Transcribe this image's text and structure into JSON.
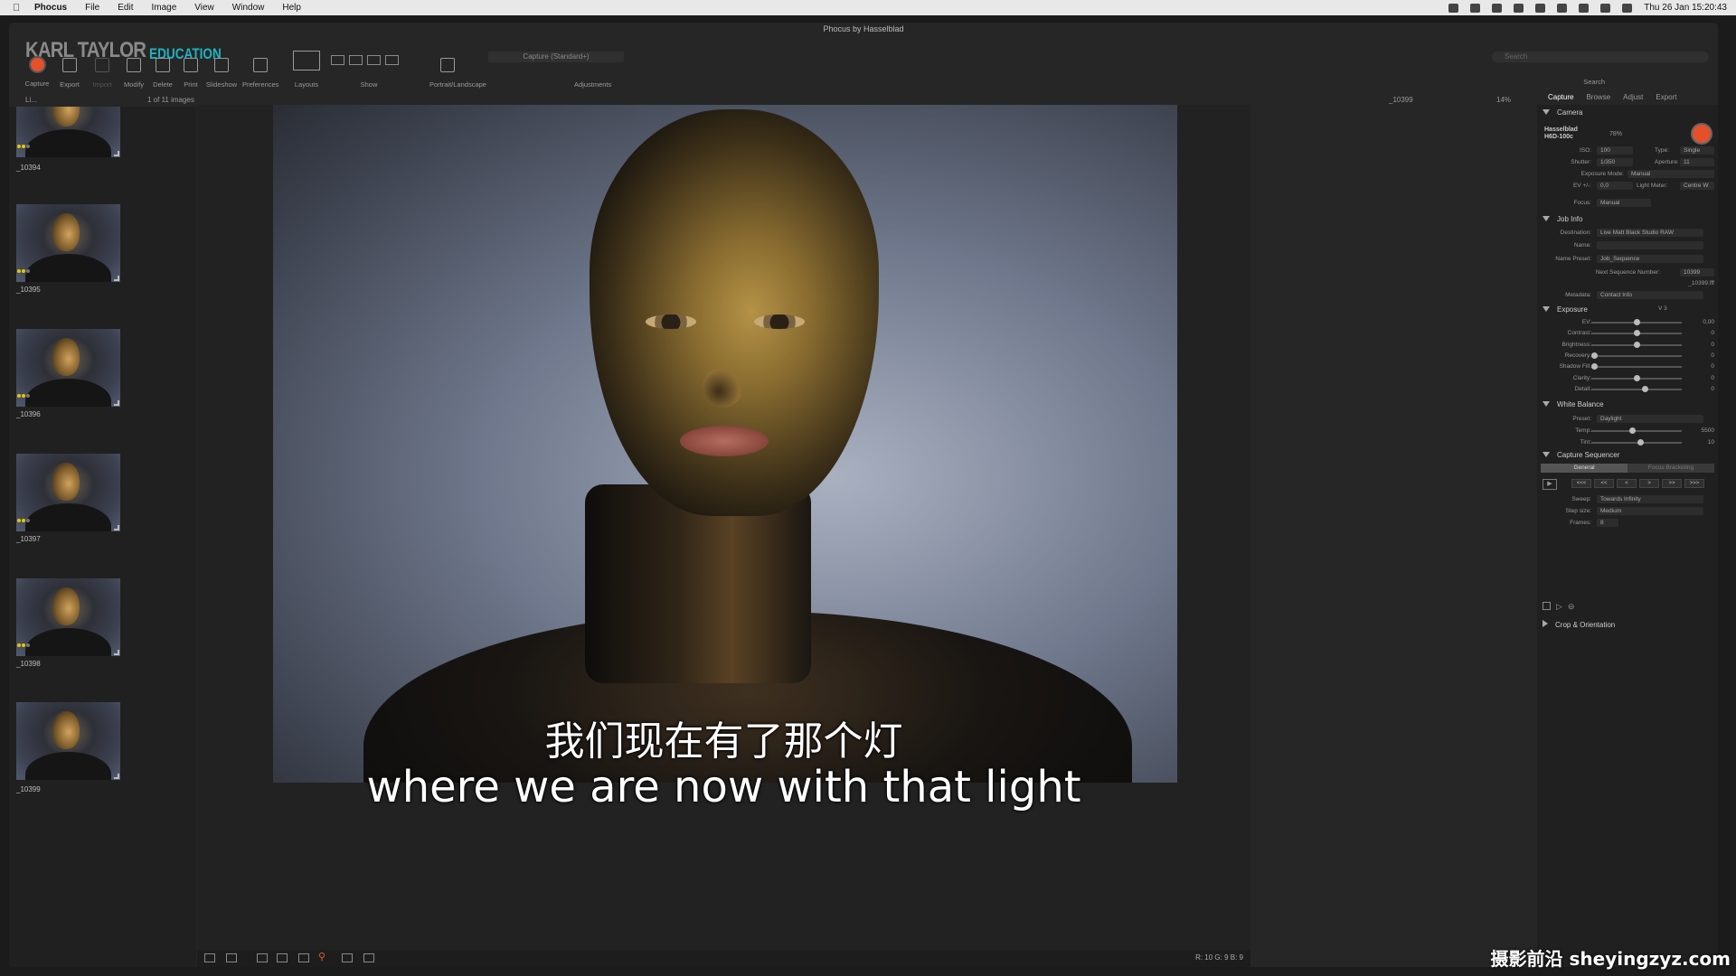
{
  "menubar": {
    "app": "Phocus",
    "items": [
      "File",
      "Edit",
      "Image",
      "View",
      "Window",
      "Help"
    ],
    "clock": "Thu 26 Jan  15:20:43"
  },
  "window": {
    "title": "Phocus by Hasselblad",
    "brand": "KARL TAYLOR",
    "brand_sub": "EDUCATION"
  },
  "toolbar": {
    "items": [
      "Capture",
      "Export",
      "Import",
      "Modify",
      "Delete",
      "Print",
      "Slideshow",
      "Preferences",
      "Layouts",
      "Show",
      "Portrait/Landscape",
      "Adjustments"
    ],
    "capture_mode": "Capture (Standard+)",
    "search_placeholder": "Search",
    "search_label": "Search"
  },
  "infobar": {
    "left": "Li...",
    "count": "1 of 11 images",
    "image_name": "_10399",
    "zoom": "14%"
  },
  "browser": {
    "thumbnails": [
      {
        "label": "_10394"
      },
      {
        "label": "_10395"
      },
      {
        "label": "_10396"
      },
      {
        "label": "_10397"
      },
      {
        "label": "_10398"
      },
      {
        "label": "_10399"
      }
    ]
  },
  "subtitles": {
    "zh": "我们现在有了那个灯",
    "en": "where we are now with that light"
  },
  "bottombar": {
    "rgb": "R: 10  G: 9  B: 9"
  },
  "panel": {
    "tabs": [
      "Capture",
      "Browse",
      "Adjust",
      "Export"
    ],
    "camera": {
      "title": "Camera",
      "model_line1": "Hasselblad",
      "model_line2": "H6D-100c",
      "battery": "78%",
      "iso_label": "ISO:",
      "iso": "100",
      "type_label": "Type:",
      "type": "Single",
      "shutter_label": "Shutter:",
      "shutter": "1/350",
      "aperture_label": "Aperture:",
      "aperture": "11",
      "exposure_mode_label": "Exposure Mode:",
      "exposure_mode": "Manual",
      "ev_label": "EV +/-:",
      "ev": "0,0",
      "light_meter_label": "Light Meter:",
      "light_meter": "Centre W",
      "focus_label": "Focus:",
      "focus": "Manual"
    },
    "job": {
      "title": "Job Info",
      "destination_label": "Destination:",
      "destination": "Live Matt Black Studio RAW",
      "name_label": "Name:",
      "name_preset_label": "Name Preset:",
      "name_preset": "Job_Sequence",
      "next_seq_label": "Next Sequence Number:",
      "next_seq": "10399",
      "next_file": "_10399.fff",
      "metadata_label": "Metadata:",
      "metadata": "Contact Info"
    },
    "exposure": {
      "title": "Exposure",
      "version": "V 3",
      "rows": [
        {
          "label": "EV:",
          "value": "0,00",
          "pos": 0.5
        },
        {
          "label": "Contrast:",
          "value": "0",
          "pos": 0.5
        },
        {
          "label": "Brightness:",
          "value": "0",
          "pos": 0.5
        },
        {
          "label": "Recovery:",
          "value": "0",
          "pos": 0.0
        },
        {
          "label": "Shadow Fill:",
          "value": "0",
          "pos": 0.0
        },
        {
          "label": "Clarity:",
          "value": "0",
          "pos": 0.5
        },
        {
          "label": "Detail:",
          "value": "0",
          "pos": 0.6
        }
      ]
    },
    "white_balance": {
      "title": "White Balance",
      "preset_label": "Preset:",
      "preset": "Daylight",
      "rows": [
        {
          "label": "Temp:",
          "value": "5500",
          "pos": 0.45
        },
        {
          "label": "Tint:",
          "value": "10",
          "pos": 0.55
        }
      ]
    },
    "sequencer": {
      "title": "Capture Sequencer",
      "tabs": [
        "General",
        "Focus Bracketing"
      ],
      "nav": [
        "<<<",
        "<<",
        "<",
        ">",
        ">>",
        ">>>"
      ],
      "sweep_label": "Sweep:",
      "sweep": "Towards Infinity",
      "step_label": "Step size:",
      "step": "Medium",
      "frames_label": "Frames:",
      "frames": "8"
    },
    "crop": {
      "title": "Crop & Orientation"
    }
  },
  "watermark": "摄影前沿 sheyingzyz.com"
}
